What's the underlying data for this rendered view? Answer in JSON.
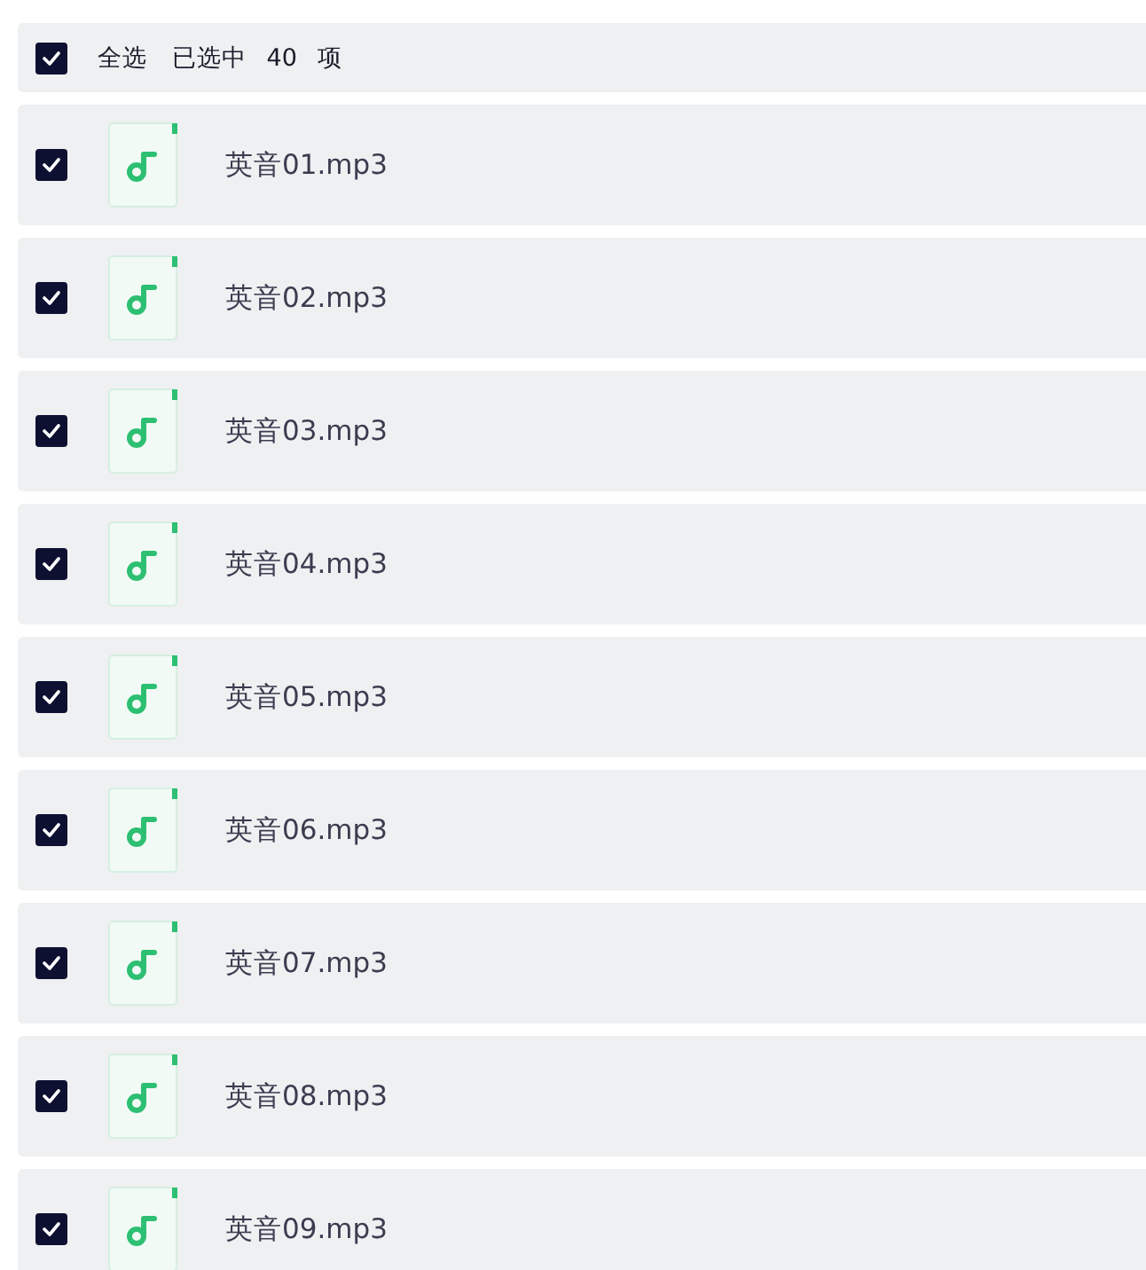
{
  "header": {
    "select_all": {
      "label": "全选",
      "checked": true
    },
    "selection_count": "已选中 40 项"
  },
  "files": [
    {
      "name": "英音01.mp3",
      "checked": true
    },
    {
      "name": "英音02.mp3",
      "checked": true
    },
    {
      "name": "英音03.mp3",
      "checked": true
    },
    {
      "name": "英音04.mp3",
      "checked": true
    },
    {
      "name": "英音05.mp3",
      "checked": true
    },
    {
      "name": "英音06.mp3",
      "checked": true
    },
    {
      "name": "英音07.mp3",
      "checked": true
    },
    {
      "name": "英音08.mp3",
      "checked": true
    },
    {
      "name": "英音09.mp3",
      "checked": true
    }
  ]
}
